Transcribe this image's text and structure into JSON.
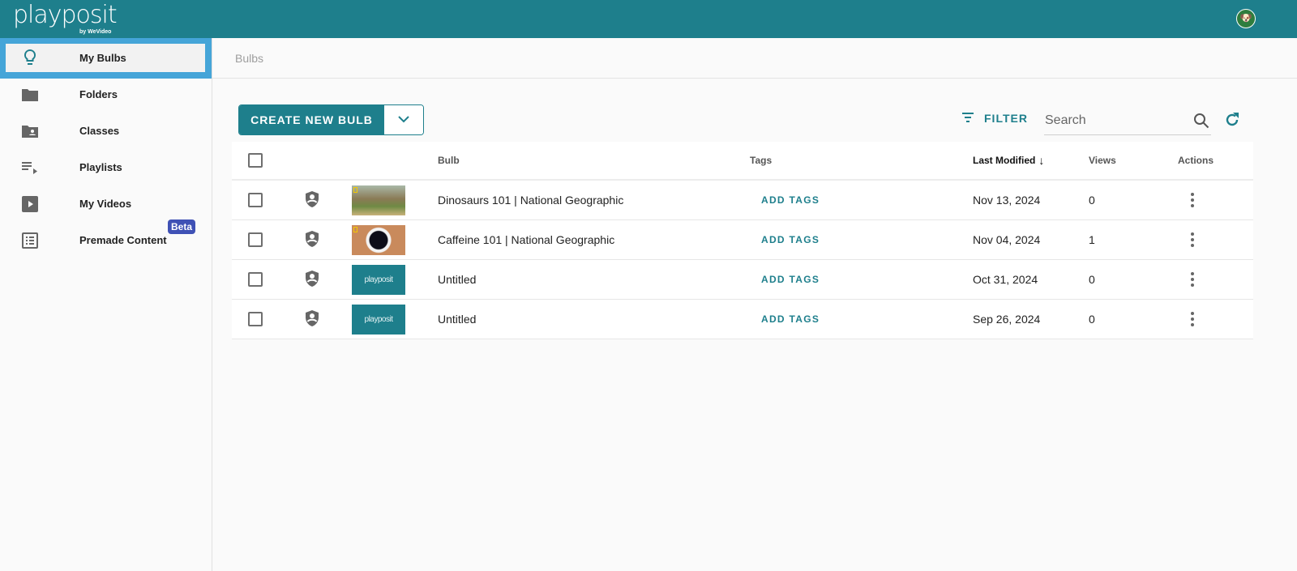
{
  "header": {
    "logo": "playposit",
    "logo_sub": "by WeVideo",
    "avatar": "user-avatar"
  },
  "sidebar": {
    "items": [
      {
        "label": "My Bulbs",
        "icon": "lightbulb-icon",
        "active": true
      },
      {
        "label": "Folders",
        "icon": "folder-icon"
      },
      {
        "label": "Classes",
        "icon": "class-folder-icon"
      },
      {
        "label": "Playlists",
        "icon": "playlist-icon"
      },
      {
        "label": "My Videos",
        "icon": "video-icon"
      },
      {
        "label": "Premade Content",
        "icon": "list-icon",
        "badge": "Beta"
      }
    ]
  },
  "breadcrumb": "Bulbs",
  "toolbar": {
    "create_label": "CREATE NEW BULB",
    "filter_label": "FILTER",
    "search_placeholder": "Search"
  },
  "table": {
    "headers": {
      "bulb": "Bulb",
      "tags": "Tags",
      "last_modified": "Last Modified",
      "views": "Views",
      "actions": "Actions"
    },
    "rows": [
      {
        "title": "Dinosaurs 101 | National Geographic",
        "tags": "ADD TAGS",
        "modified": "Nov 13, 2024",
        "views": "0",
        "thumb": "dino"
      },
      {
        "title": "Caffeine 101 | National Geographic",
        "tags": "ADD TAGS",
        "modified": "Nov 04, 2024",
        "views": "1",
        "thumb": "coffee"
      },
      {
        "title": "Untitled",
        "tags": "ADD TAGS",
        "modified": "Oct 31, 2024",
        "views": "0",
        "thumb": "playposit"
      },
      {
        "title": "Untitled",
        "tags": "ADD TAGS",
        "modified": "Sep 26, 2024",
        "views": "0",
        "thumb": "playposit"
      }
    ]
  },
  "colors": {
    "brand": "#1e7f8c",
    "active_border": "#45a5d8",
    "beta": "#3f51b5"
  }
}
